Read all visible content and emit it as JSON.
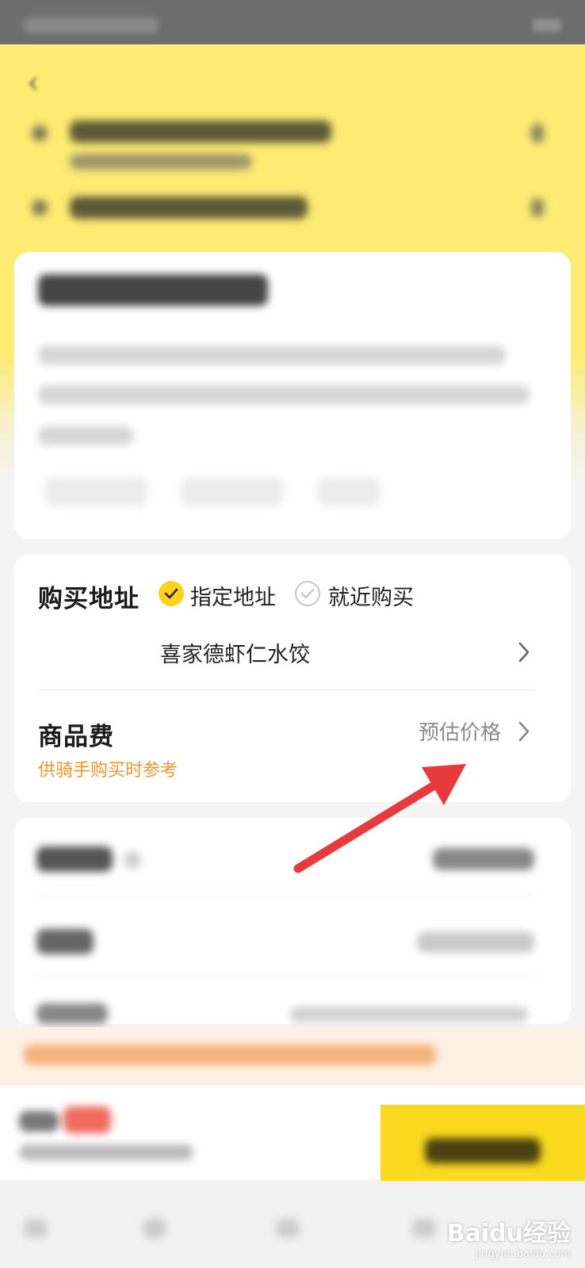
{
  "address_section": {
    "title": "购买地址",
    "option_specified": "指定地址",
    "option_nearby": "就近购买",
    "shop_name": "喜家德虾仁水饺"
  },
  "goods_fee": {
    "title": "商品费",
    "hint": "供骑手购买时参考",
    "estimate_label": "预估价格"
  },
  "watermark": {
    "brand": "Baidu经验",
    "url": "jingyan.baidu.com"
  },
  "colors": {
    "header_yellow": "#fdeb72",
    "check_yellow": "#fcd21a",
    "orange_hint": "#f0962a",
    "arrow_red": "#e8393b",
    "submit_yellow": "#fad91f"
  }
}
